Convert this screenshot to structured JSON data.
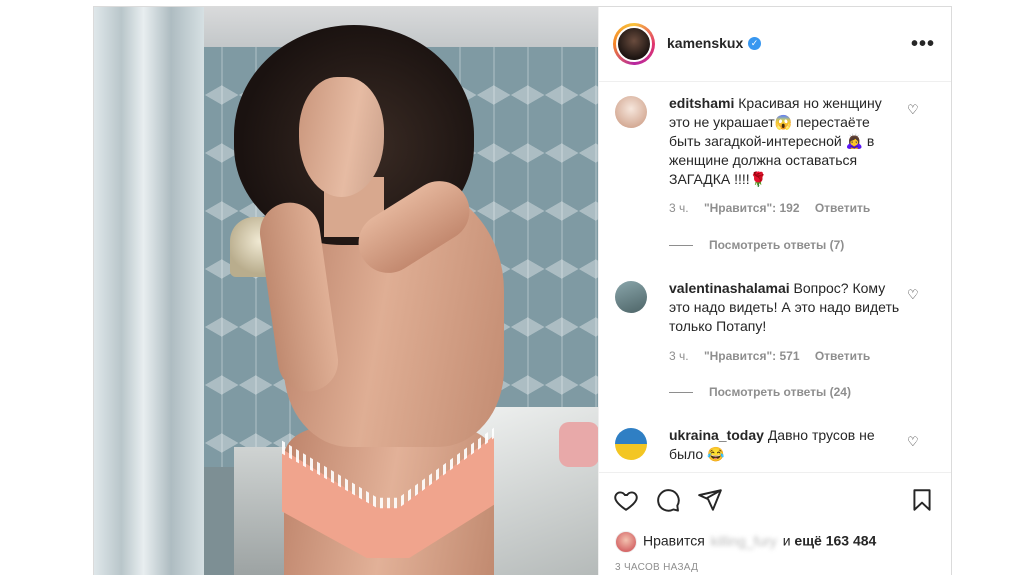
{
  "post": {
    "username": "kamenskux",
    "verified_icon": "verified-badge-icon",
    "more_icon": "more-options-icon"
  },
  "comments": [
    {
      "user": "editshami",
      "text": "Красивая но женщину это не украшает😱 перестаёте быть загадкой-интересной 🙇‍♀️ в женщине должна оставаться ЗАГАДКА !!!!🌹",
      "time": "3 ч.",
      "likes": "\"Нравится\": 192",
      "reply": "Ответить",
      "view_replies": "Посмотреть ответы (7)",
      "avatar_color": "#e9d2c6"
    },
    {
      "user": "valentinashalamai",
      "text": "Вопрос? Кому это надо видеть! А это надо видеть только Потапу!",
      "time": "3 ч.",
      "likes": "\"Нравится\": 571",
      "reply": "Ответить",
      "view_replies": "Посмотреть ответы (24)",
      "avatar_color": "#6f8a8f"
    },
    {
      "user": "ukraina_today",
      "text": "Давно трусов не было 😂",
      "avatar_color": "#2f7fc4"
    }
  ],
  "footer": {
    "likes_prefix": "Нравится",
    "liked_by_blurred": "killing_fury",
    "likes_and": "и",
    "likes_count": "ещё 163 484",
    "timestamp": "3 ЧАСОВ НАЗАД"
  },
  "icons": {
    "like": "heart-icon",
    "comment": "comment-icon",
    "share": "share-icon",
    "save": "bookmark-icon"
  }
}
